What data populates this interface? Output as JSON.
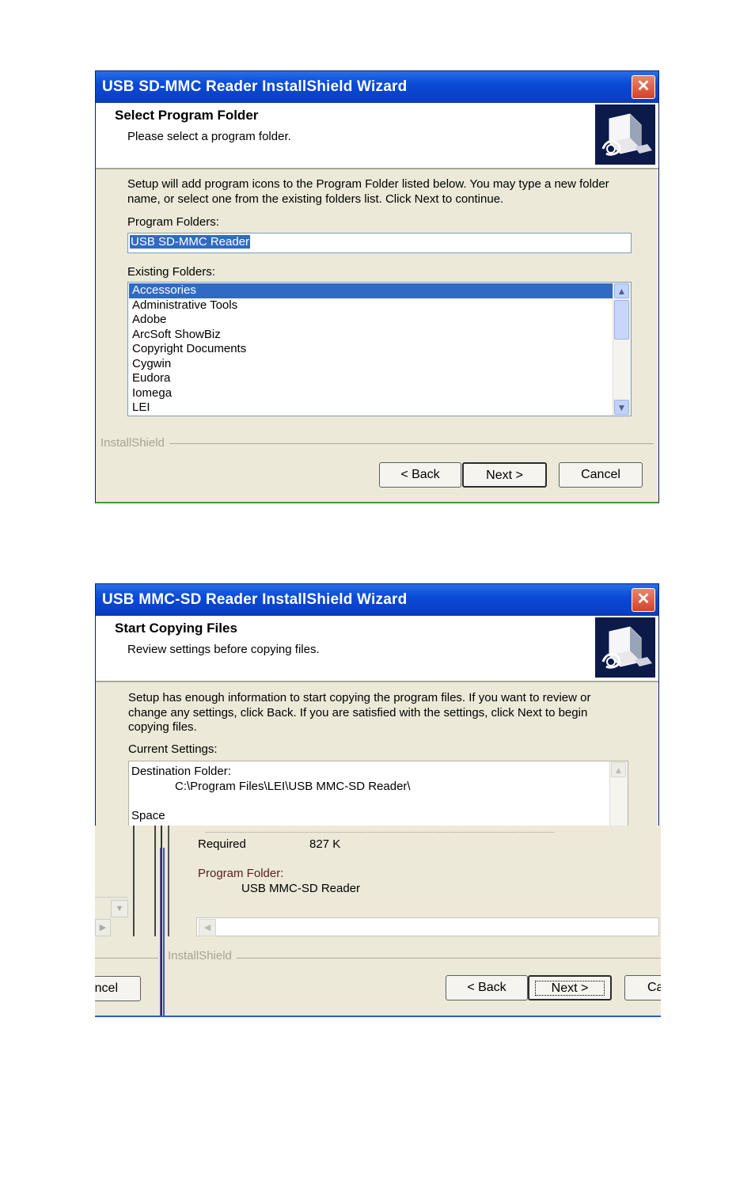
{
  "dialog1": {
    "title": "USB SD-MMC Reader  InstallShield Wizard",
    "close_glyph": "✕",
    "header_title": "Select Program Folder",
    "header_subtitle": "Please select a program folder.",
    "description_line1": "Setup will add program icons to the Program Folder listed below.  You may type a new folder",
    "description_line2": "name, or select one from the existing folders list.  Click Next to continue.",
    "program_folders_label": "Program Folders:",
    "program_folder_value": "USB SD-MMC Reader",
    "existing_folders_label": "Existing Folders:",
    "existing_folders": [
      "Accessories",
      "Administrative Tools",
      "Adobe",
      "ArcSoft ShowBiz",
      "Copyright Documents",
      "Cygwin",
      "Eudora",
      "Iomega",
      "LEI"
    ],
    "selected_folder_index": 0,
    "brand": "InstallShield",
    "back_label": "< Back",
    "next_label": "Next >",
    "cancel_label": "Cancel",
    "icons": {
      "close": "close-icon",
      "logo": "installer-computer-icon",
      "scroll_up": "chevron-up-icon",
      "scroll_down": "chevron-down-icon"
    }
  },
  "dialog2": {
    "title": "USB MMC-SD Reader  InstallShield Wizard",
    "close_glyph": "✕",
    "header_title": "Start Copying Files",
    "header_subtitle": "Review settings before copying files.",
    "description_line1": "Setup has enough information to start copying the program files.  If you want to review or",
    "description_line2": "change any settings, click Back.  If you are satisfied with the settings, click Next to begin",
    "description_line3": "copying files.",
    "current_settings_label": "Current Settings:",
    "destination_label": "Destination Folder:",
    "destination_value": "C:\\Program Files\\LEI\\USB MMC-SD Reader\\",
    "space_label": "Space",
    "required_label": "Required",
    "required_value": "827 K",
    "program_folder_label": "Program Folder:",
    "program_folder_value": "USB MMC-SD Reader",
    "brand": "InstallShield",
    "back_label": "< Back",
    "next_label": "Next >",
    "cancel_fragment_left": "ncel",
    "cancel_fragment_right": "Ca"
  },
  "colors": {
    "titlebar": "#0a4ad6",
    "window_bg": "#ece9d8",
    "selection": "#316ac5",
    "close": "#d1432a"
  }
}
